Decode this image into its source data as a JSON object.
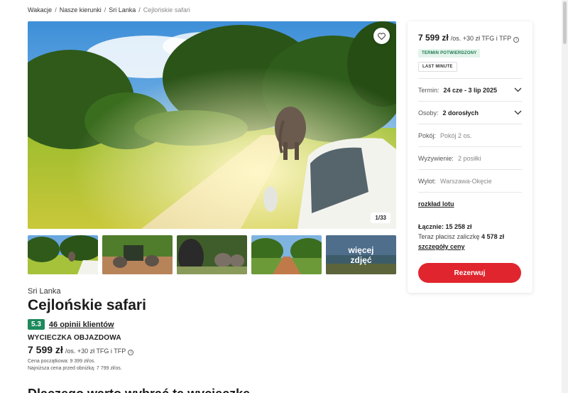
{
  "breadcrumb": {
    "items": [
      "Wakacje",
      "Nasze kierunki",
      "Sri Lanka"
    ],
    "separator": "/",
    "current": "Cejlońskie safari"
  },
  "gallery": {
    "counter": "1/33",
    "more_line1": "więcej",
    "more_line2": "zdjęć",
    "favorite_icon": "heart-icon"
  },
  "offer": {
    "country": "Sri Lanka",
    "title": "Cejlońskie safari",
    "rating": "5.3",
    "reviews_link": "46 opinii klientów",
    "trip_type": "WYCIECZKA OBJAZDOWA",
    "price": "7 599 zł",
    "price_suffix": "/os. +30 zł TFG i TFP",
    "initial_price": "Cena początkowa: 9 399 zł/os.",
    "lowest_price": "Najniższa cena przed obniżką: 7 799 zł/os.",
    "next_heading": "Dlaczego warto wybrać tę wycieczkę"
  },
  "booking": {
    "price": "7 599 zł",
    "price_suffix": "/os. +30 zł TFG i TFP",
    "tag_confirmed": "TERMIN POTWIERDZONY",
    "tag_last_minute": "LAST MINUTE",
    "term_label": "Termin:",
    "term_value": "24 cze - 3 lip 2025",
    "persons_label": "Osoby:",
    "persons_value": "2 dorosłych",
    "room_label": "Pokój:",
    "room_value": "Pokój 2 os.",
    "board_label": "Wyżywienie:",
    "board_value": "2 posiłki",
    "flight_label": "Wylot:",
    "flight_value": "Warszawa-Okęcie",
    "flight_schedule_link": "rozkład lotu",
    "total": "Łącznie: 15 258 zł",
    "advance_prefix": "Teraz płacisz zaliczkę",
    "advance_amount": "4 578 zł",
    "details_link": "szczegóły ceny",
    "reserve_button": "Rezerwuj"
  },
  "colors": {
    "accent_red": "#e0252e",
    "rating_green": "#1d8a5b",
    "tag_green_bg": "#e4f4ec"
  }
}
